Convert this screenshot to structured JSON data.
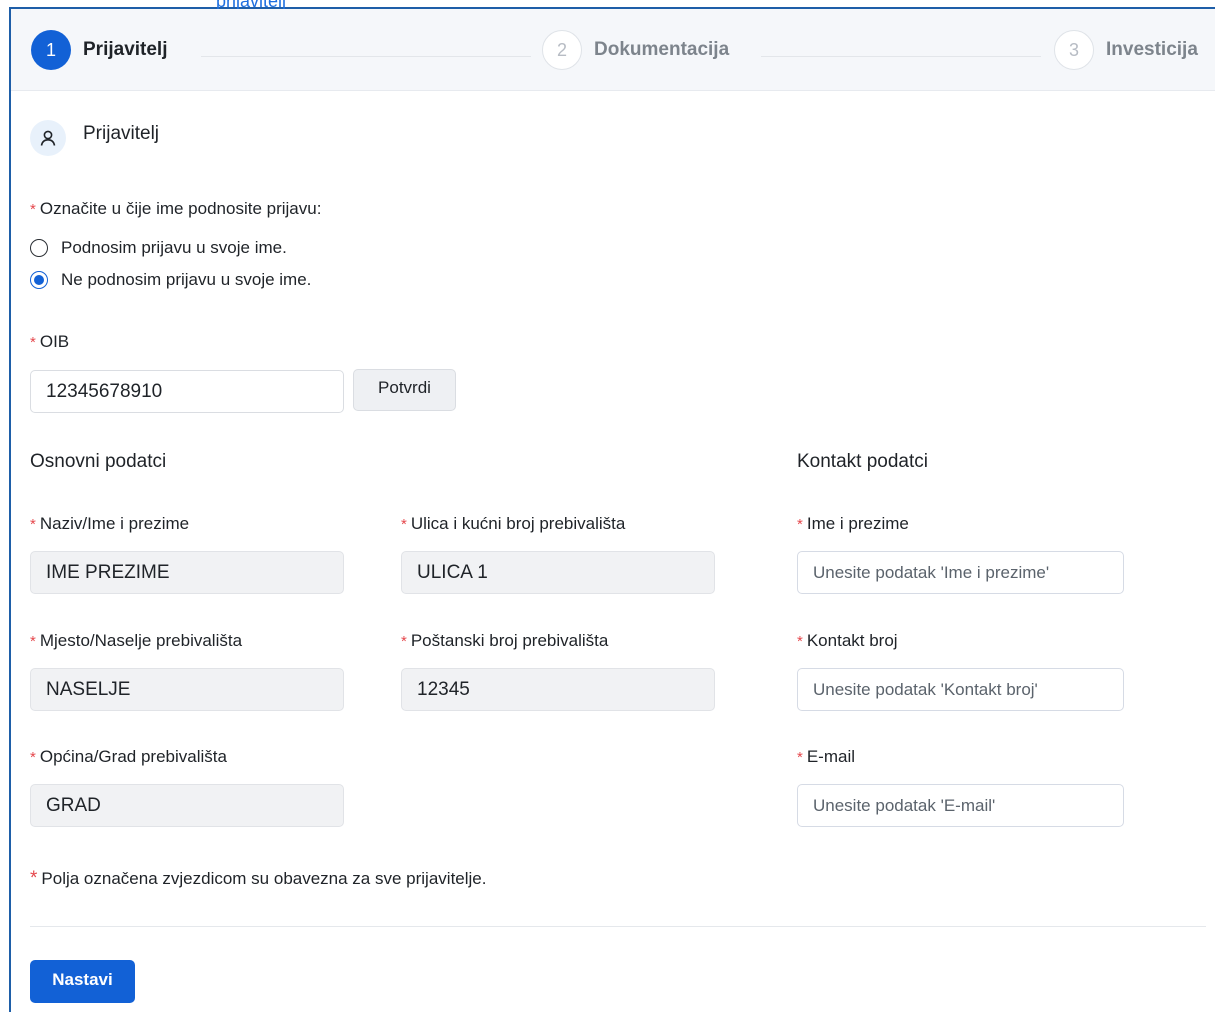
{
  "top_link": "prijavitelj",
  "stepper": {
    "steps": [
      {
        "number": "1",
        "label": "Prijavitelj"
      },
      {
        "number": "2",
        "label": "Dokumentacija"
      },
      {
        "number": "3",
        "label": "Investicija"
      }
    ],
    "active_step": 1
  },
  "section": {
    "title": "Prijavitelj",
    "icon": "user-icon"
  },
  "applicant_type": {
    "label": "Označite u čije ime podnosite prijavu:",
    "options": [
      "Podnosim prijavu u svoje ime.",
      "Ne podnosim prijavu u svoje ime."
    ],
    "selected": 1
  },
  "oib": {
    "label": "OIB",
    "value": "12345678910",
    "confirm_label": "Potvrdi"
  },
  "basic_data": {
    "heading": "Osnovni podatci",
    "name": {
      "label": "Naziv/Ime i prezime",
      "value": "IME PREZIME"
    },
    "street": {
      "label": "Ulica i kućni broj prebivališta",
      "value": "ULICA 1"
    },
    "place": {
      "label": "Mjesto/Naselje prebivališta",
      "value": "NASELJE"
    },
    "postal": {
      "label": "Poštanski broj prebivališta",
      "value": "12345"
    },
    "city": {
      "label": "Općina/Grad prebivališta",
      "value": "GRAD"
    }
  },
  "contact_data": {
    "heading": "Kontakt podatci",
    "full_name": {
      "label": "Ime i prezime",
      "placeholder": "Unesite podatak 'Ime i prezime'"
    },
    "phone": {
      "label": "Kontakt broj",
      "placeholder": "Unesite podatak 'Kontakt broj'"
    },
    "email": {
      "label": "E-mail",
      "placeholder": "Unesite podatak 'E-mail'"
    }
  },
  "required_mark": "*",
  "footnote": "Polja označena zvjezdicom su obavezna za sve prijavitelje.",
  "continue_label": "Nastavi",
  "colors": {
    "primary": "#1261d6",
    "required": "#e5484d",
    "frame": "#1e5ea8"
  }
}
